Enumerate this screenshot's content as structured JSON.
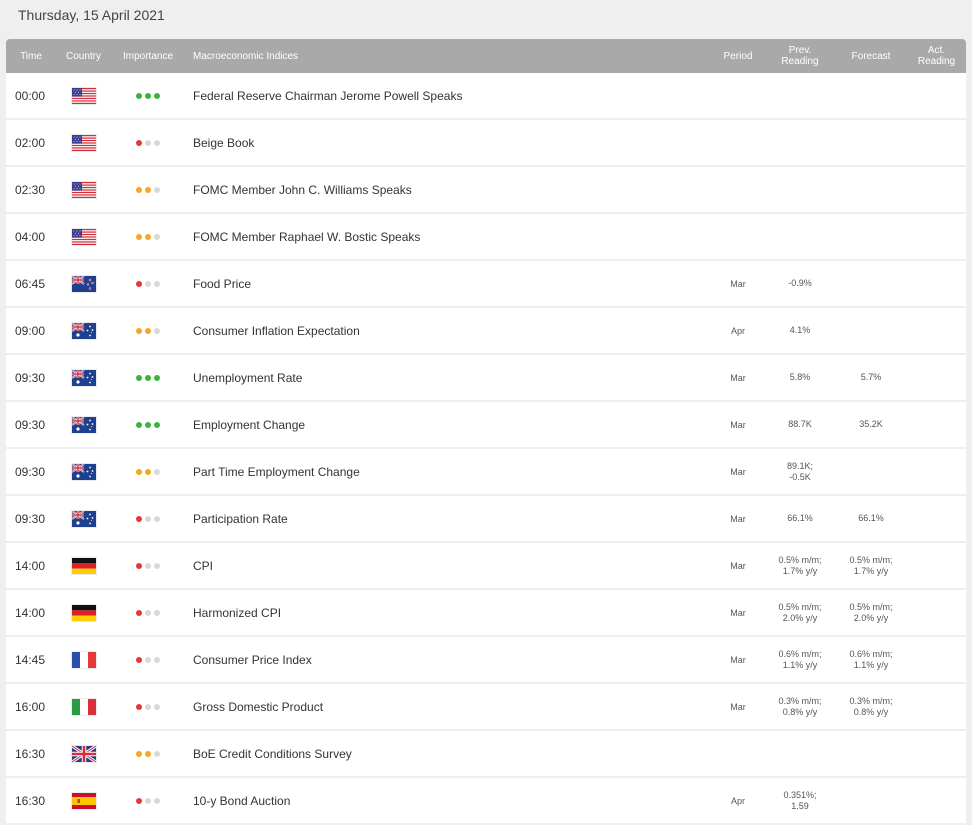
{
  "date_header": "Thursday, 15 April 2021",
  "columns": {
    "time": "Time",
    "country": "Country",
    "importance": "Importance",
    "indices": "Macroeconomic Indices",
    "period": "Period",
    "prev_line1": "Prev.",
    "prev_line2": "Reading",
    "forecast": "Forecast",
    "actual_line1": "Act.",
    "actual_line2": "Reading"
  },
  "importance_colors": {
    "high": "#3cb13c",
    "medium": "#f5a623",
    "low": "#e53935",
    "off": "#d9d9d9"
  },
  "rows": [
    {
      "time": "00:00",
      "country": "us-flag",
      "importance": 3,
      "index": "Federal Reserve Chairman Jerome Powell Speaks",
      "period": "",
      "prev1": "",
      "prev2": "",
      "fc1": "",
      "fc2": "",
      "actual": ""
    },
    {
      "time": "02:00",
      "country": "us-flag",
      "importance": 1,
      "index": "Beige Book",
      "period": "",
      "prev1": "",
      "prev2": "",
      "fc1": "",
      "fc2": "",
      "actual": ""
    },
    {
      "time": "02:30",
      "country": "us-flag",
      "importance": 2,
      "index": "FOMC Member John C. Williams Speaks",
      "period": "",
      "prev1": "",
      "prev2": "",
      "fc1": "",
      "fc2": "",
      "actual": ""
    },
    {
      "time": "04:00",
      "country": "us-flag",
      "importance": 2,
      "index": "FOMC Member Raphael W. Bostic Speaks",
      "period": "",
      "prev1": "",
      "prev2": "",
      "fc1": "",
      "fc2": "",
      "actual": ""
    },
    {
      "time": "06:45",
      "country": "nz-flag",
      "importance": 1,
      "index": "Food Price",
      "period": "Mar",
      "prev1": "-0.9%",
      "prev2": "",
      "fc1": "",
      "fc2": "",
      "actual": ""
    },
    {
      "time": "09:00",
      "country": "au-flag",
      "importance": 2,
      "index": "Consumer Inflation Expectation",
      "period": "Apr",
      "prev1": "4.1%",
      "prev2": "",
      "fc1": "",
      "fc2": "",
      "actual": ""
    },
    {
      "time": "09:30",
      "country": "au-flag",
      "importance": 3,
      "index": "Unemployment Rate",
      "period": "Mar",
      "prev1": "5.8%",
      "prev2": "",
      "fc1": "5.7%",
      "fc2": "",
      "actual": ""
    },
    {
      "time": "09:30",
      "country": "au-flag",
      "importance": 3,
      "index": "Employment Change",
      "period": "Mar",
      "prev1": "88.7K",
      "prev2": "",
      "fc1": "35.2K",
      "fc2": "",
      "actual": ""
    },
    {
      "time": "09:30",
      "country": "au-flag",
      "importance": 2,
      "index": "Part Time Employment Change",
      "period": "Mar",
      "prev1": "89.1K;",
      "prev2": "-0.5K",
      "fc1": "",
      "fc2": "",
      "actual": ""
    },
    {
      "time": "09:30",
      "country": "au-flag",
      "importance": 1,
      "index": "Participation Rate",
      "period": "Mar",
      "prev1": "66.1%",
      "prev2": "",
      "fc1": "66.1%",
      "fc2": "",
      "actual": ""
    },
    {
      "time": "14:00",
      "country": "de-flag",
      "importance": 1,
      "index": "CPI",
      "period": "Mar",
      "prev1": "0.5% m/m;",
      "prev2": "1.7% y/y",
      "fc1": "0.5% m/m;",
      "fc2": "1.7% y/y",
      "actual": ""
    },
    {
      "time": "14:00",
      "country": "de-flag",
      "importance": 1,
      "index": "Harmonized CPI",
      "period": "Mar",
      "prev1": "0.5% m/m;",
      "prev2": "2.0% y/y",
      "fc1": "0.5% m/m;",
      "fc2": "2.0% y/y",
      "actual": ""
    },
    {
      "time": "14:45",
      "country": "fr-flag",
      "importance": 1,
      "index": "Consumer Price Index",
      "period": "Mar",
      "prev1": "0.6% m/m;",
      "prev2": "1.1% y/y",
      "fc1": "0.6% m/m;",
      "fc2": "1.1% y/y",
      "actual": ""
    },
    {
      "time": "16:00",
      "country": "it-flag",
      "importance": 1,
      "index": "Gross Domestic Product",
      "period": "Mar",
      "prev1": "0.3% m/m;",
      "prev2": "0.8% y/y",
      "fc1": "0.3% m/m;",
      "fc2": "0.8% y/y",
      "actual": ""
    },
    {
      "time": "16:30",
      "country": "uk-flag",
      "importance": 2,
      "index": "BoE Credit Conditions Survey",
      "period": "",
      "prev1": "",
      "prev2": "",
      "fc1": "",
      "fc2": "",
      "actual": ""
    },
    {
      "time": "16:30",
      "country": "es-flag",
      "importance": 1,
      "index": "10-y Bond Auction",
      "period": "Apr",
      "prev1": "0.351%;",
      "prev2": "1.59",
      "fc1": "",
      "fc2": "",
      "actual": ""
    }
  ]
}
